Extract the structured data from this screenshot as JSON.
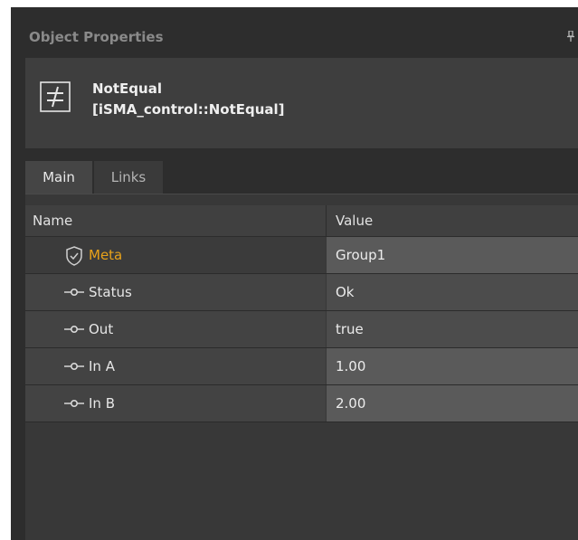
{
  "panel": {
    "title": "Object Properties",
    "pin_glyph": "⊥"
  },
  "component": {
    "icon": "not-equal-icon",
    "name": "NotEqual",
    "type": "[iSMA_control::NotEqual]"
  },
  "tabs": [
    {
      "label": "Main",
      "active": true
    },
    {
      "label": "Links",
      "active": false
    }
  ],
  "grid": {
    "columns": [
      "Name",
      "Value"
    ],
    "rows": [
      {
        "name": "Meta",
        "value": "Group1",
        "icon": "shield-icon",
        "highlight": true
      },
      {
        "name": "Status",
        "value": "Ok",
        "icon": "slot-icon"
      },
      {
        "name": "Out",
        "value": "true",
        "icon": "slot-icon"
      },
      {
        "name": "In A",
        "value": "1.00",
        "icon": "slot-icon"
      },
      {
        "name": "In B",
        "value": "2.00",
        "icon": "slot-icon"
      }
    ]
  },
  "colors": {
    "panel_bg": "#2d2d2d",
    "meta_label": "#e8a21a"
  }
}
